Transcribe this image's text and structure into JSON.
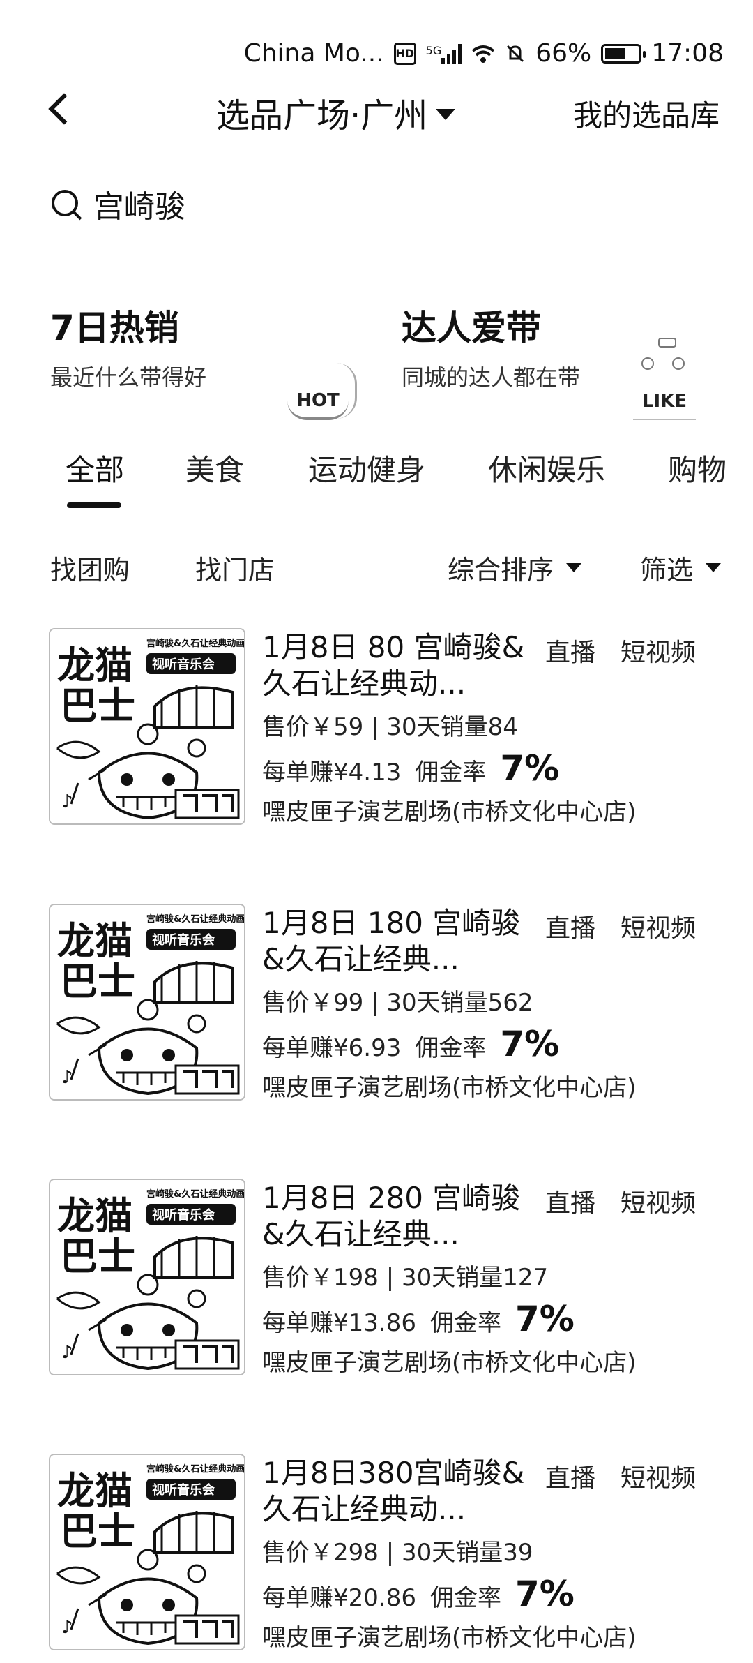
{
  "status_bar": {
    "carrier": "China Mo...",
    "hd": "HD",
    "network": "5G",
    "battery": "66%",
    "battery_level": 0.66,
    "time": "17:08"
  },
  "nav": {
    "title": "选品广场·广州",
    "right_link": "我的选品库"
  },
  "search": {
    "value": "宫崎骏"
  },
  "features": [
    {
      "title": "7日热销",
      "subtitle": "最近什么带得好",
      "badge": "HOT"
    },
    {
      "title": "达人爱带",
      "subtitle": "同城的达人都在带",
      "badge": "LIKE"
    }
  ],
  "tabs": [
    "全部",
    "美食",
    "运动健身",
    "休闲娱乐",
    "购物"
  ],
  "active_tab": "全部",
  "filters": {
    "group_buy": "找团购",
    "find_store": "找门店",
    "sort": "综合排序",
    "filter": "筛选"
  },
  "products": [
    {
      "title": "1月8日 80 宫崎骏&久石让经典动...",
      "tag_live": "直播",
      "tag_video": "短视频",
      "price": "售价￥59 | 30天销量84",
      "earn": "每单赚¥4.13",
      "rate_label": "佣金率",
      "rate": "7%",
      "store": "嘿皮匣子演艺剧场(市桥文化中心店)"
    },
    {
      "title": "1月8日 180 宫崎骏&久石让经典...",
      "tag_live": "直播",
      "tag_video": "短视频",
      "price": "售价￥99 | 30天销量562",
      "earn": "每单赚¥6.93",
      "rate_label": "佣金率",
      "rate": "7%",
      "store": "嘿皮匣子演艺剧场(市桥文化中心店)"
    },
    {
      "title": "1月8日 280 宫崎骏&久石让经典...",
      "tag_live": "直播",
      "tag_video": "短视频",
      "price": "售价￥198 | 30天销量127",
      "earn": "每单赚¥13.86",
      "rate_label": "佣金率",
      "rate": "7%",
      "store": "嘿皮匣子演艺剧场(市桥文化中心店)"
    },
    {
      "title": "1月8日380宫崎骏&久石让经典动...",
      "tag_live": "直播",
      "tag_video": "短视频",
      "price": "售价￥298 | 30天销量39",
      "earn": "每单赚¥20.86",
      "rate_label": "佣金率",
      "rate": "7%",
      "store": "嘿皮匣子演艺剧场(市桥文化中心店)"
    }
  ],
  "poster": {
    "brand": "龙猫巴士",
    "subtitle": "视听音乐会",
    "heading": "宫崎骏&久石让经典动画电影"
  }
}
